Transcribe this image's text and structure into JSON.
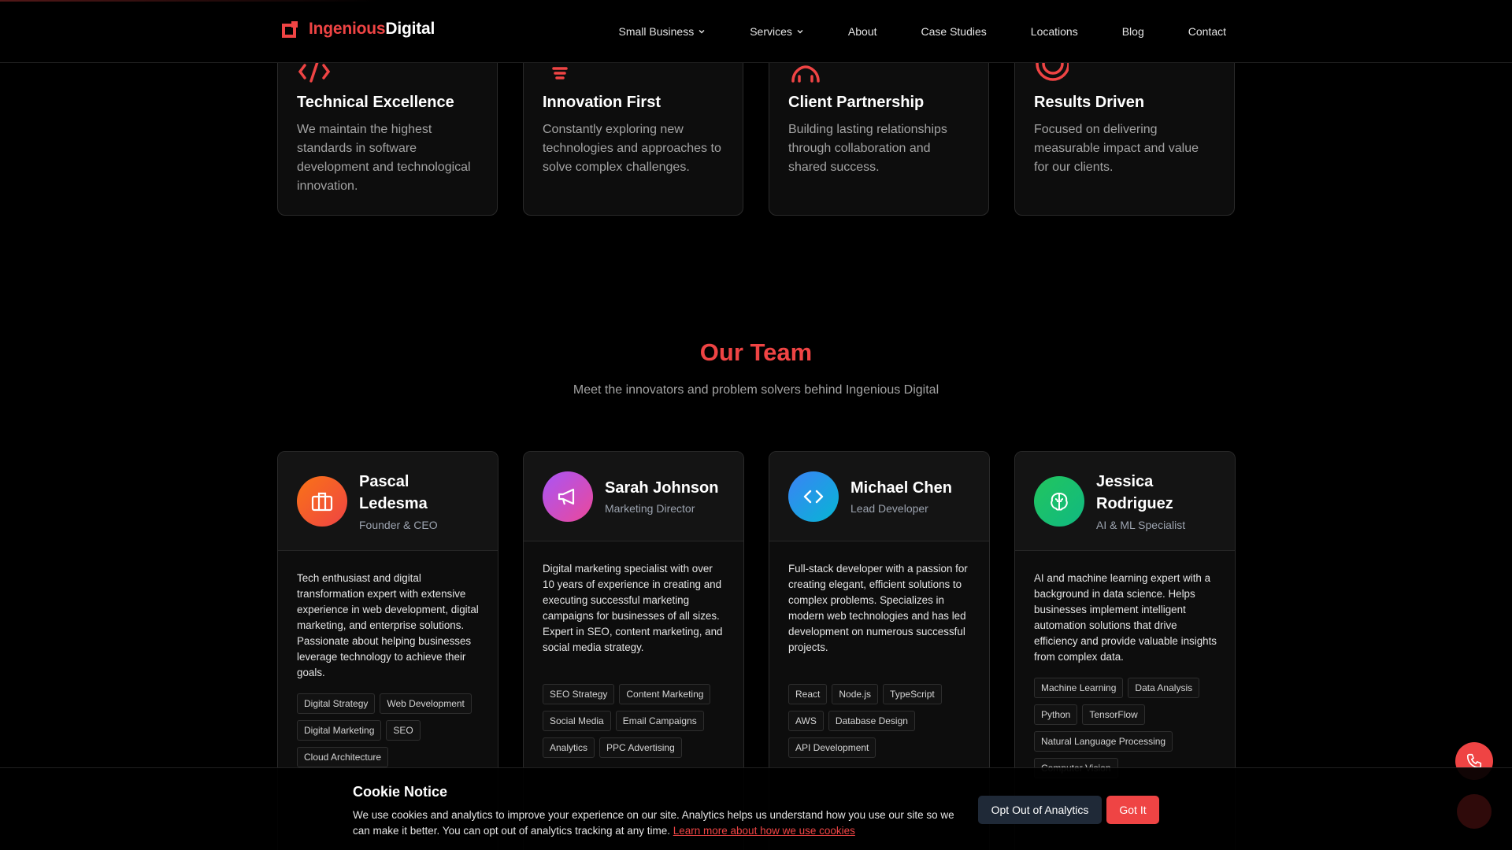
{
  "brand": {
    "name_part1": "Ingenious",
    "name_part2": "Digital",
    "accent": "#ef4444"
  },
  "nav": {
    "items": [
      {
        "label": "Small Business",
        "has_dropdown": true
      },
      {
        "label": "Services",
        "has_dropdown": true
      },
      {
        "label": "About",
        "has_dropdown": false
      },
      {
        "label": "Case Studies",
        "has_dropdown": false
      },
      {
        "label": "Locations",
        "has_dropdown": false
      },
      {
        "label": "Blog",
        "has_dropdown": false
      },
      {
        "label": "Contact",
        "has_dropdown": false
      }
    ]
  },
  "values": [
    {
      "icon": "code-icon",
      "title": "Technical Excellence",
      "desc": "We maintain the highest standards in software development and technological innovation."
    },
    {
      "icon": "lightbulb-icon",
      "title": "Innovation First",
      "desc": "Constantly exploring new technologies and approaches to solve complex challenges."
    },
    {
      "icon": "users-icon",
      "title": "Client Partnership",
      "desc": "Building lasting relationships through collaboration and shared success."
    },
    {
      "icon": "target-icon",
      "title": "Results Driven",
      "desc": "Focused on delivering measurable impact and value for our clients."
    }
  ],
  "team": {
    "title": "Our Team",
    "subtitle": "Meet the innovators and problem solvers behind Ingenious Digital",
    "members": [
      {
        "name": "Pascal Ledesma",
        "role": "Founder & CEO",
        "icon": "briefcase-icon",
        "bio": "Tech enthusiast and digital transformation expert with extensive experience in web development, digital marketing, and enterprise solutions. Passionate about helping businesses leverage technology to achieve their goals.",
        "tags": [
          "Digital Strategy",
          "Web Development",
          "Digital Marketing",
          "SEO",
          "Cloud Architecture"
        ]
      },
      {
        "name": "Sarah Johnson",
        "role": "Marketing Director",
        "icon": "megaphone-icon",
        "bio": "Digital marketing specialist with over 10 years of experience in creating and executing successful marketing campaigns for businesses of all sizes. Expert in SEO, content marketing, and social media strategy.",
        "tags": [
          "SEO Strategy",
          "Content Marketing",
          "Social Media",
          "Email Campaigns",
          "Analytics",
          "PPC Advertising"
        ]
      },
      {
        "name": "Michael Chen",
        "role": "Lead Developer",
        "icon": "code-brackets-icon",
        "bio": "Full-stack developer with a passion for creating elegant, efficient solutions to complex problems. Specializes in modern web technologies and has led development on numerous successful projects.",
        "tags": [
          "React",
          "Node.js",
          "TypeScript",
          "AWS",
          "Database Design",
          "API Development"
        ]
      },
      {
        "name": "Jessica Rodriguez",
        "role": "AI & ML Specialist",
        "icon": "brain-icon",
        "bio": "AI and machine learning expert with a background in data science. Helps businesses implement intelligent automation solutions that drive efficiency and provide valuable insights from complex data.",
        "tags": [
          "Machine Learning",
          "Data Analysis",
          "Python",
          "TensorFlow",
          "Natural Language Processing",
          "Computer Vision"
        ]
      }
    ]
  },
  "cookie": {
    "title": "Cookie Notice",
    "text": "We use cookies and analytics to improve your experience on our site. Analytics helps us understand how you use our site so we can make it better. You can opt out of analytics tracking at any time.",
    "link": "Learn more about how we use cookies",
    "opt_out_label": "Opt Out of Analytics",
    "accept_label": "Got It"
  },
  "floating": {
    "call_icon": "phone-icon"
  }
}
